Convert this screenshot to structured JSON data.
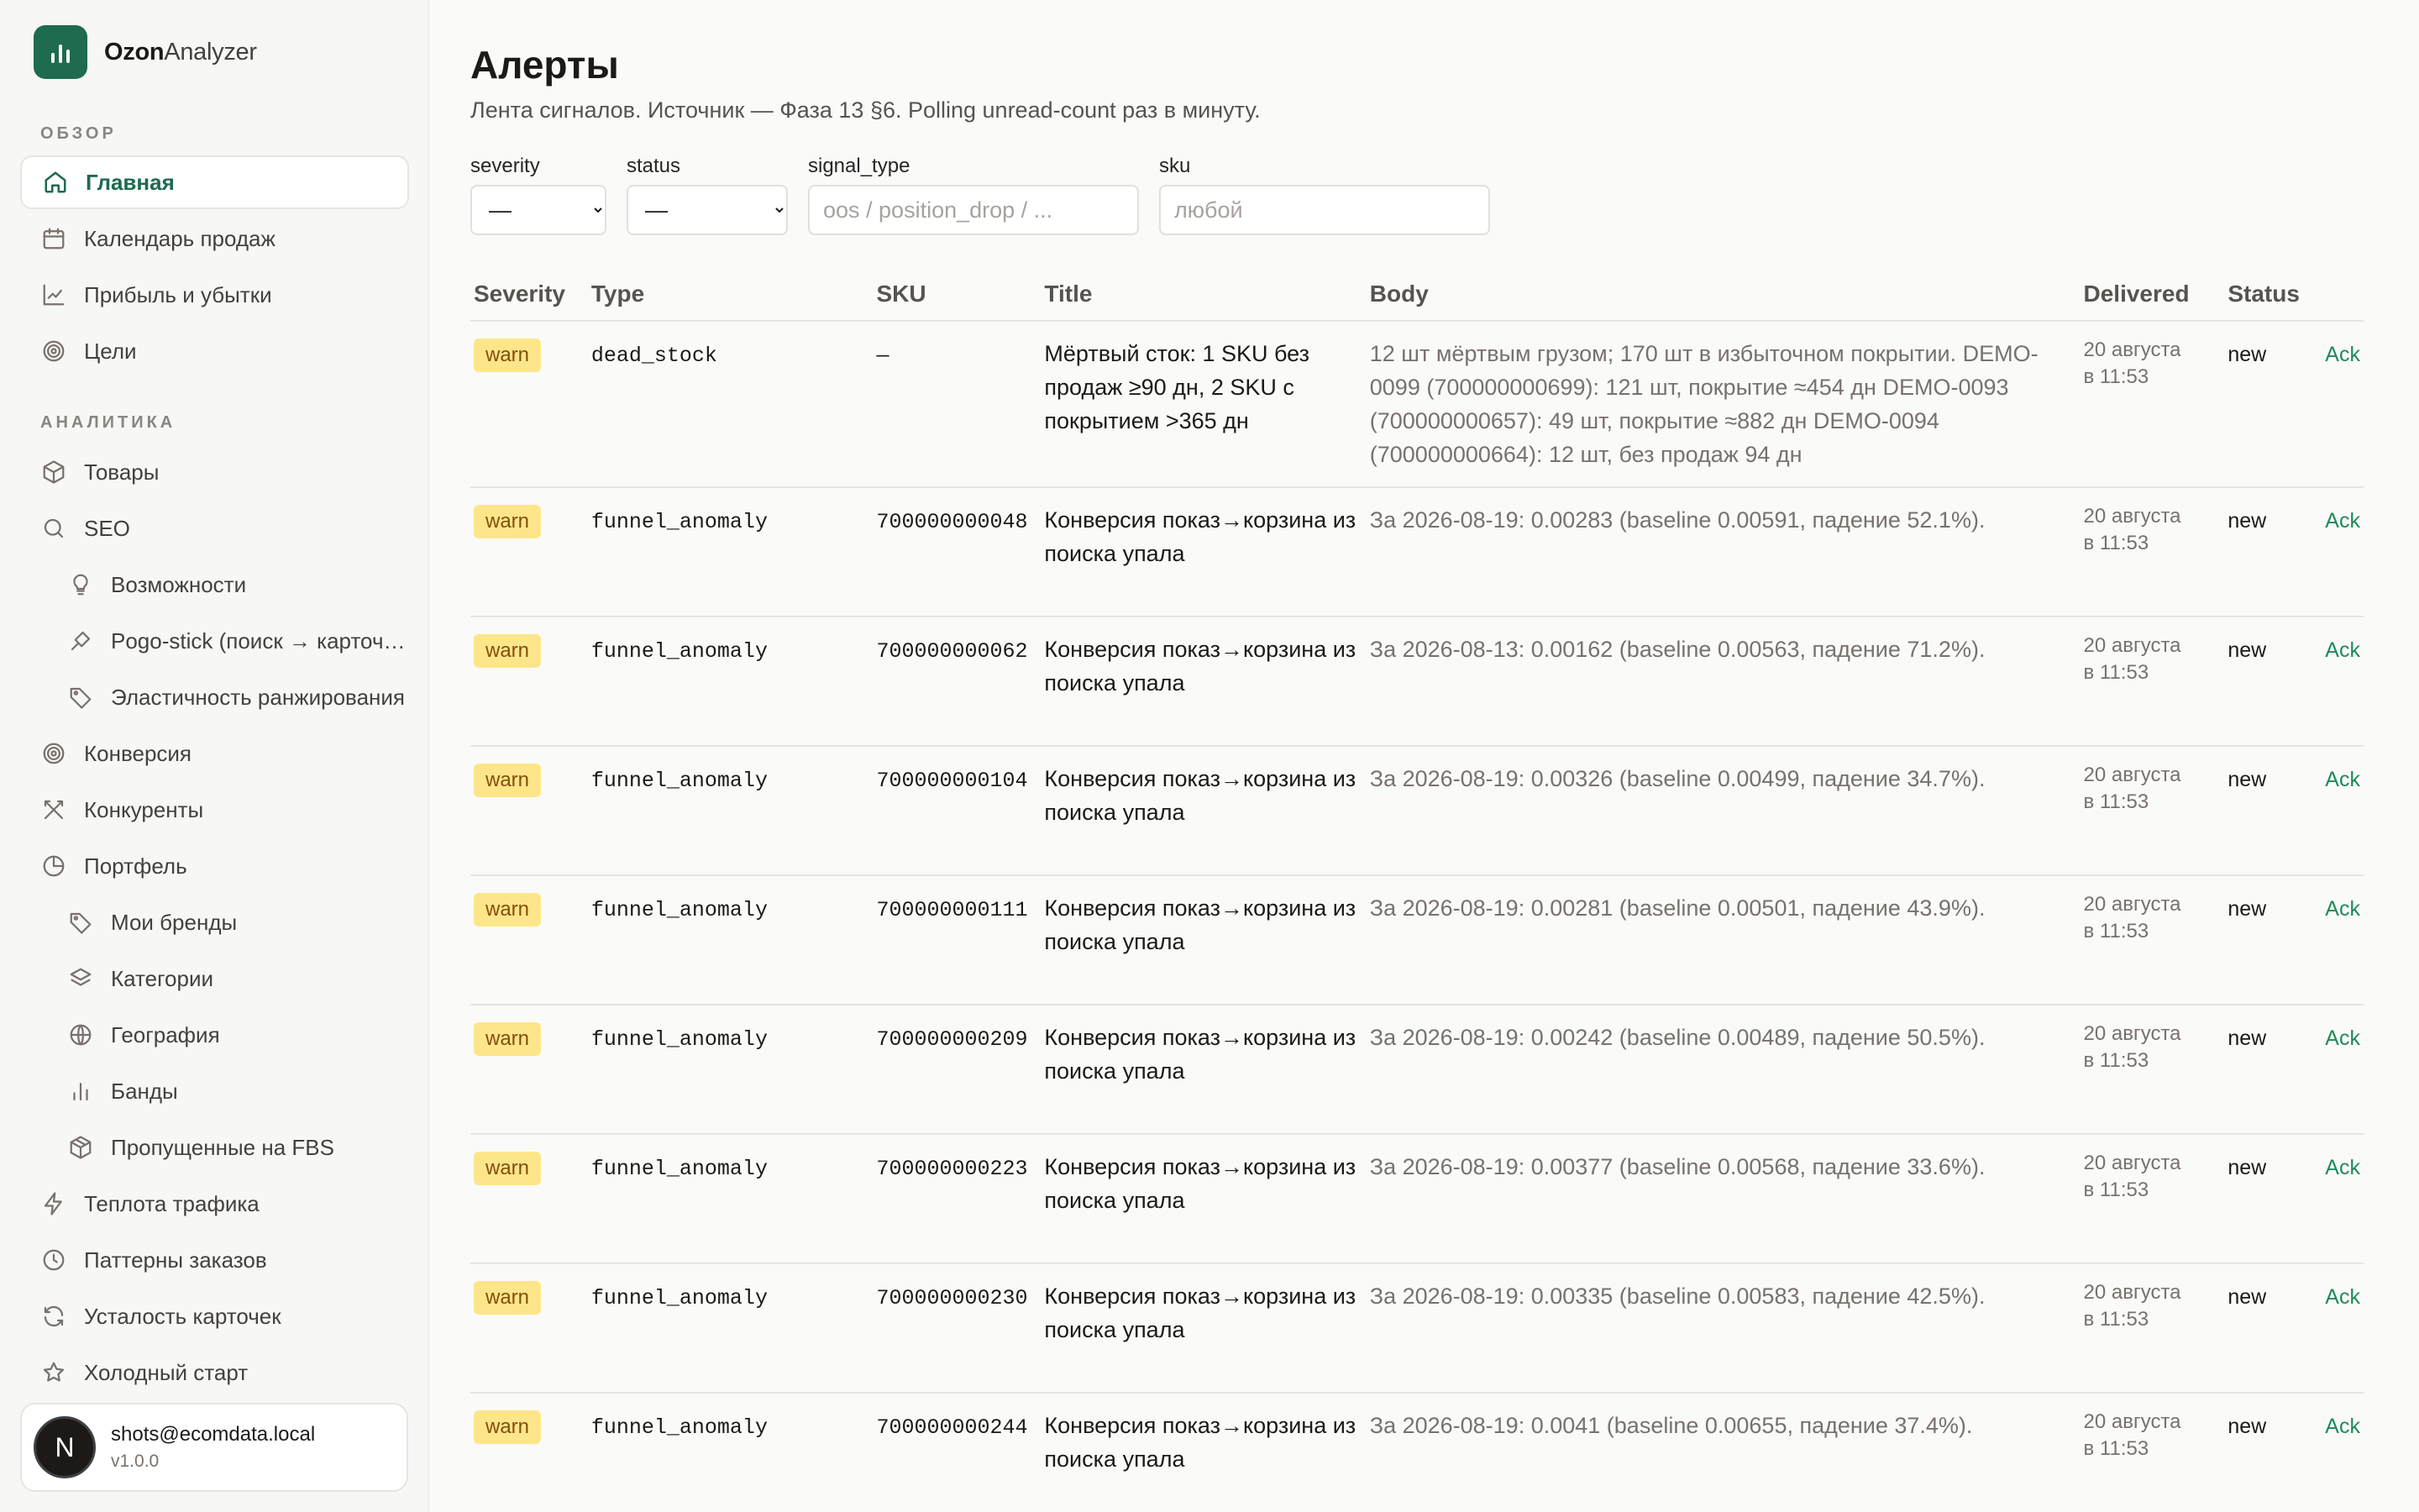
{
  "app": {
    "name_bold": "Ozon",
    "name_rest": "Analyzer"
  },
  "sidebar": {
    "sections": [
      {
        "label": "ОБЗОР"
      },
      {
        "label": "АНАЛИТИКА"
      }
    ],
    "items": [
      {
        "label": "Главная",
        "icon": "home-icon"
      },
      {
        "label": "Календарь продаж",
        "icon": "calendar-icon"
      },
      {
        "label": "Прибыль и убытки",
        "icon": "line-chart-icon"
      },
      {
        "label": "Цели",
        "icon": "target-icon"
      },
      {
        "label": "Товары",
        "icon": "package-icon"
      },
      {
        "label": "SEO",
        "icon": "search-icon"
      },
      {
        "label": "Возможности",
        "icon": "lightbulb-icon"
      },
      {
        "label": "Pogo-stick (поиск → карточка)",
        "icon": "pogo-icon"
      },
      {
        "label": "Эластичность ранжирования",
        "icon": "tag-icon"
      },
      {
        "label": "Конверсия",
        "icon": "target-icon"
      },
      {
        "label": "Конкуренты",
        "icon": "swords-icon"
      },
      {
        "label": "Портфель",
        "icon": "pie-chart-icon"
      },
      {
        "label": "Мои бренды",
        "icon": "tag-icon"
      },
      {
        "label": "Категории",
        "icon": "layers-icon"
      },
      {
        "label": "География",
        "icon": "globe-icon"
      },
      {
        "label": "Банды",
        "icon": "bar-chart-icon"
      },
      {
        "label": "Пропущенные на FBS",
        "icon": "boxes-icon"
      },
      {
        "label": "Теплота трафика",
        "icon": "zap-icon"
      },
      {
        "label": "Паттерны заказов",
        "icon": "clock-icon"
      },
      {
        "label": "Усталость карточек",
        "icon": "refresh-icon"
      },
      {
        "label": "Холодный старт",
        "icon": "star-icon"
      }
    ],
    "user": {
      "initial": "N",
      "email": "shots@ecomdata.local",
      "version": "v1.0.0"
    }
  },
  "page": {
    "title": "Алерты",
    "subtitle": "Лента сигналов. Источник — Фаза 13 §6. Polling unread-count раз в минуту."
  },
  "filters": {
    "severity": {
      "label": "severity",
      "value": "—"
    },
    "status": {
      "label": "status",
      "value": "—"
    },
    "signal_type": {
      "label": "signal_type",
      "placeholder": "oos / position_drop / ..."
    },
    "sku": {
      "label": "sku",
      "placeholder": "любой"
    }
  },
  "table": {
    "headers": {
      "severity": "Severity",
      "type": "Type",
      "sku": "SKU",
      "title": "Title",
      "body": "Body",
      "delivered": "Delivered",
      "status": "Status"
    },
    "ack_label": "Ack",
    "rows": [
      {
        "severity": "warn",
        "type": "dead_stock",
        "sku": "—",
        "title": "Мёртвый сток: 1 SKU без продаж ≥90 дн, 2 SKU с покрытием >365 дн",
        "body": "12 шт мёртвым грузом; 170 шт в избыточном покрытии. DEMO-0099 (700000000699): 121 шт, покрытие ≈454 дн DEMO-0093 (700000000657): 49 шт, покрытие ≈882 дн DEMO-0094 (700000000664): 12 шт, без продаж 94 дн",
        "delivered_date": "20 августа",
        "delivered_time": "в 11:53",
        "status": "new"
      },
      {
        "severity": "warn",
        "type": "funnel_anomaly",
        "sku": "700000000048",
        "title": "Конверсия показ→корзина из поиска упала",
        "body": "За 2026-08-19: 0.00283 (baseline 0.00591, падение 52.1%).",
        "delivered_date": "20 августа",
        "delivered_time": "в 11:53",
        "status": "new"
      },
      {
        "severity": "warn",
        "type": "funnel_anomaly",
        "sku": "700000000062",
        "title": "Конверсия показ→корзина из поиска упала",
        "body": "За 2026-08-13: 0.00162 (baseline 0.00563, падение 71.2%).",
        "delivered_date": "20 августа",
        "delivered_time": "в 11:53",
        "status": "new"
      },
      {
        "severity": "warn",
        "type": "funnel_anomaly",
        "sku": "700000000104",
        "title": "Конверсия показ→корзина из поиска упала",
        "body": "За 2026-08-19: 0.00326 (baseline 0.00499, падение 34.7%).",
        "delivered_date": "20 августа",
        "delivered_time": "в 11:53",
        "status": "new"
      },
      {
        "severity": "warn",
        "type": "funnel_anomaly",
        "sku": "700000000111",
        "title": "Конверсия показ→корзина из поиска упала",
        "body": "За 2026-08-19: 0.00281 (baseline 0.00501, падение 43.9%).",
        "delivered_date": "20 августа",
        "delivered_time": "в 11:53",
        "status": "new"
      },
      {
        "severity": "warn",
        "type": "funnel_anomaly",
        "sku": "700000000209",
        "title": "Конверсия показ→корзина из поиска упала",
        "body": "За 2026-08-19: 0.00242 (baseline 0.00489, падение 50.5%).",
        "delivered_date": "20 августа",
        "delivered_time": "в 11:53",
        "status": "new"
      },
      {
        "severity": "warn",
        "type": "funnel_anomaly",
        "sku": "700000000223",
        "title": "Конверсия показ→корзина из поиска упала",
        "body": "За 2026-08-19: 0.00377 (baseline 0.00568, падение 33.6%).",
        "delivered_date": "20 августа",
        "delivered_time": "в 11:53",
        "status": "new"
      },
      {
        "severity": "warn",
        "type": "funnel_anomaly",
        "sku": "700000000230",
        "title": "Конверсия показ→корзина из поиска упала",
        "body": "За 2026-08-19: 0.00335 (baseline 0.00583, падение 42.5%).",
        "delivered_date": "20 августа",
        "delivered_time": "в 11:53",
        "status": "new"
      },
      {
        "severity": "warn",
        "type": "funnel_anomaly",
        "sku": "700000000244",
        "title": "Конверсия показ→корзина из поиска упала",
        "body": "За 2026-08-19: 0.0041 (baseline 0.00655, падение 37.4%).",
        "delivered_date": "20 августа",
        "delivered_time": "в 11:53",
        "status": "new"
      }
    ]
  },
  "colors": {
    "accent": "#1e6b4e",
    "warn_bg": "#fde68a",
    "ack": "#1e8a5a"
  }
}
